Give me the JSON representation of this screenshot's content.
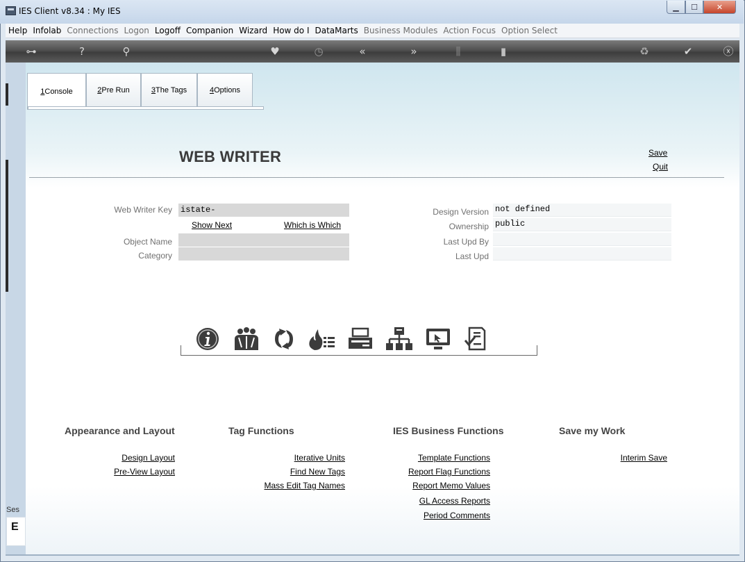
{
  "window": {
    "title": "IES Client v8.34 : My IES"
  },
  "menu": [
    {
      "label": "Help",
      "enabled": true
    },
    {
      "label": "Infolab",
      "enabled": true
    },
    {
      "label": "Connections",
      "enabled": false
    },
    {
      "label": "Logon",
      "enabled": false
    },
    {
      "label": "Logoff",
      "enabled": true
    },
    {
      "label": "Companion",
      "enabled": true
    },
    {
      "label": "Wizard",
      "enabled": true
    },
    {
      "label": "How do I",
      "enabled": true
    },
    {
      "label": "DataMarts",
      "enabled": true
    },
    {
      "label": "Business Modules",
      "enabled": false
    },
    {
      "label": "Action Focus",
      "enabled": false
    },
    {
      "label": "Option Select",
      "enabled": false
    }
  ],
  "toolbar_icons": [
    "key-icon",
    "help-icon",
    "search-icon",
    "heart-icon",
    "clock-icon",
    "back-icon",
    "forward-icon",
    "stats-icon",
    "document-icon",
    "recycle-icon",
    "check-icon",
    "close-icon"
  ],
  "tabs": [
    {
      "num": "1",
      "label": " Console",
      "active": true
    },
    {
      "num": "2",
      "label": " Pre Run",
      "active": false
    },
    {
      "num": "3",
      "label": " The Tags",
      "active": false
    },
    {
      "num": "4",
      "label": " Options",
      "active": false
    }
  ],
  "page": {
    "title": "WEB WRITER",
    "save": "Save",
    "quit": "Quit"
  },
  "form": {
    "key_label": "Web Writer Key",
    "key_value": "istate-",
    "show_next": "Show Next",
    "which_is_which": "Which is Which",
    "object_name_label": "Object Name",
    "object_name_value": "",
    "category_label": "Category",
    "category_value": "",
    "design_version_label": "Design Version",
    "design_version_value": "not defined",
    "ownership_label": "Ownership",
    "ownership_value": "public",
    "last_upd_by_label": "Last Upd By",
    "last_upd_by_value": "",
    "last_upd_label": "Last Upd",
    "last_upd_value": ""
  },
  "action_icons": [
    "info-icon",
    "users-icon",
    "refresh-icon",
    "fire-list-icon",
    "printer-icon",
    "hierarchy-icon",
    "monitor-icon",
    "checklist-icon"
  ],
  "sections": {
    "appearance": {
      "title": "Appearance and Layout",
      "links": [
        "Design Layout",
        "Pre-View Layout"
      ]
    },
    "tags": {
      "title": "Tag Functions",
      "links": [
        "Iterative Units",
        "Find New Tags",
        "Mass Edit Tag Names"
      ]
    },
    "business": {
      "title": "IES Business Functions",
      "links": [
        "Template Functions",
        "Report Flag Functions",
        "Report Memo Values",
        "GL Access Reports",
        "Period Comments"
      ]
    },
    "save": {
      "title": "Save my Work",
      "links": [
        "Interim Save"
      ]
    }
  },
  "session": {
    "label": "Ses",
    "glyph": "E"
  },
  "colors": {
    "accent": "#cfe6ef",
    "heading": "#3a3a3a",
    "icon": "#3c3c3c"
  }
}
